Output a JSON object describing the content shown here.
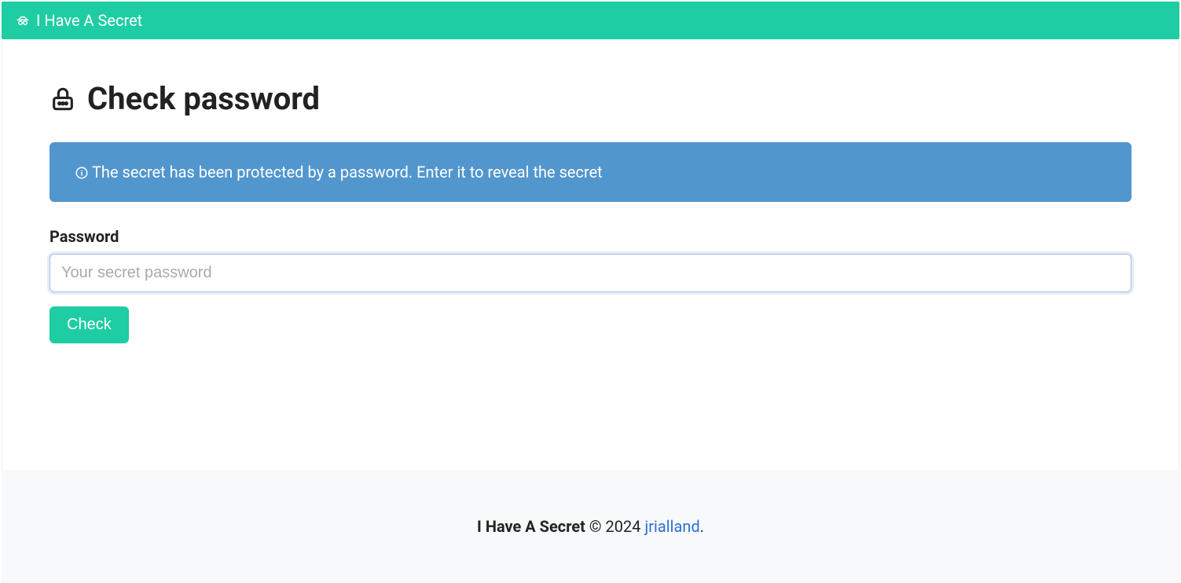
{
  "navbar": {
    "title": "I Have A Secret"
  },
  "page": {
    "title": "Check password",
    "alert": "The secret has been protected by a password. Enter it to reveal the secret"
  },
  "form": {
    "password_label": "Password",
    "password_placeholder": "Your secret password",
    "check_button": "Check"
  },
  "footer": {
    "brand": "I Have A Secret",
    "copyright": " © 2024 ",
    "author": "jrialland",
    "period": "."
  },
  "colors": {
    "accent": "#1ecda3",
    "alert_bg": "#5296ce",
    "link": "#2a6fd6"
  }
}
